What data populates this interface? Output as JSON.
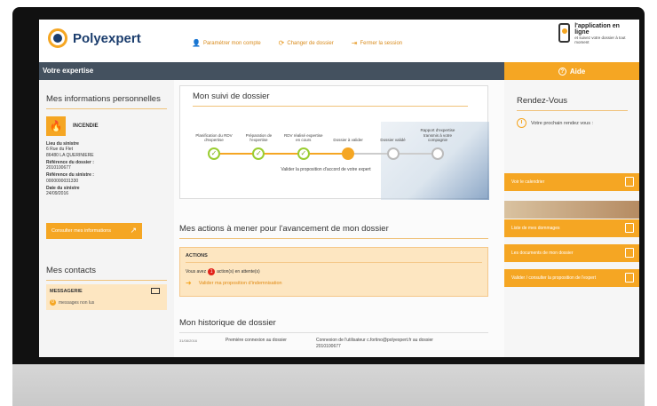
{
  "brand": {
    "name": "Polyexpert"
  },
  "topnav": [
    {
      "label": "Paramétrer mon compte"
    },
    {
      "label": "Changer de dossier"
    },
    {
      "label": "Fermer la session"
    }
  ],
  "app_promo": {
    "title": "l'application en ligne",
    "subtitle": "et suivez votre dossier à tout moment"
  },
  "bar": {
    "title": "Votre expertise",
    "help": "Aide"
  },
  "left": {
    "personal_title": "Mes informations personnelles",
    "claim_type": "INCENDIE",
    "info": [
      {
        "label": "Lieu du sinistre",
        "value": "6 Rue du Flet\n86480 LA QUERINIERE"
      },
      {
        "label": "Référence du dossier :",
        "value": "2010100677"
      },
      {
        "label": "Référence du sinistre :",
        "value": "0000000031330"
      },
      {
        "label": "Date du sinistre",
        "value": "24/09/2016"
      }
    ],
    "consult_button": "Consulter mes informations",
    "contacts_title": "Mes contacts",
    "messaging_label": "MESSAGERIE",
    "unread_count": "0",
    "unread_label": "messages non lus"
  },
  "suivi": {
    "title": "Mon suivi de dossier",
    "steps": [
      {
        "label": "Planification du RDV d'expertise",
        "status": "done"
      },
      {
        "label": "Préparation de l'expertise",
        "status": "done"
      },
      {
        "label": "RDV réalisé expertise en cours",
        "status": "done"
      },
      {
        "label": "Dossier à valider",
        "status": "current"
      },
      {
        "label": "Dossier validé",
        "status": "todo"
      },
      {
        "label": "Rapport d'expertise transmis à votre compagnie",
        "status": "todo"
      }
    ],
    "note": "Valider la proposition d'accord de votre expert"
  },
  "actions": {
    "title": "Mes actions à mener pour l'avancement de mon dossier",
    "head": "ACTIONS",
    "prefix": "Vous avez",
    "count": "1",
    "suffix": "action(s) en attente(s)",
    "link": "Valider ma proposition d'indemnisation"
  },
  "history": {
    "title": "Mon historique de dossier",
    "rows": [
      {
        "date": "31/08/2016",
        "event": "Première connexion au dossier",
        "text": "Connexion de l'utilisateur c.fortino@polyexpert.fr au dossier 2010100677"
      }
    ]
  },
  "right": {
    "rdv_title": "Rendez-Vous",
    "rdv_text": "Votre prochain rendez vous :",
    "buttons": [
      {
        "label": "Voir le calendrier"
      },
      {
        "label": "Liste de mes dommages"
      },
      {
        "label": "Les documents de mon dossier"
      },
      {
        "label": "Valider / consulter la proposition de l'expert"
      }
    ]
  },
  "colors": {
    "accent": "#f5a623",
    "bar": "#44515f",
    "brand": "#1b3d6d",
    "done": "#9acd32"
  }
}
